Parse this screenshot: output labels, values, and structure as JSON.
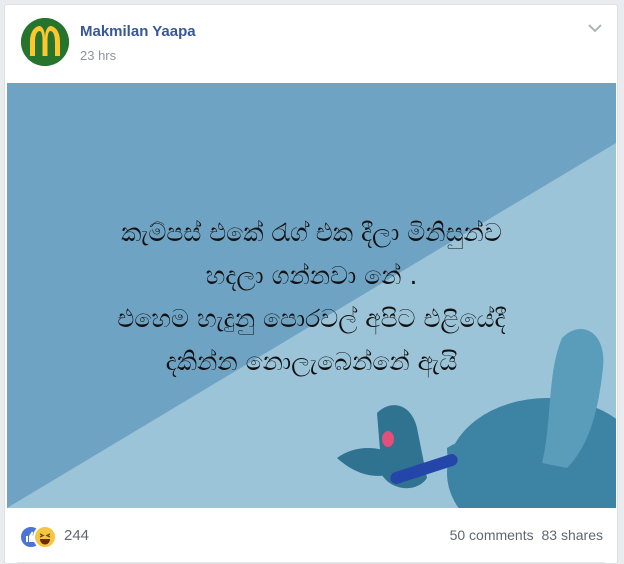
{
  "post": {
    "author": "Makmilan Yaapa",
    "time": "23 hrs",
    "text_lines": [
      "කැම්පස් එකේ රැග් එක දීලා මිනිසුන්ව",
      "හදලා ගන්නවා නේ .",
      "එහෙම හැදුනු පොරවල් අපිට එළියේදී",
      "දකින්න නොලැබෙන්නේ ඇයි"
    ],
    "background_colors": {
      "dark": "#6fa3c3",
      "light": "#9cc4d9",
      "character": "#2f7391"
    }
  },
  "footer": {
    "reaction_count": "244",
    "comments": "50 comments",
    "shares": "83 shares"
  },
  "icons": {
    "avatar": "golden-arches-logo",
    "menu": "chevron-down-icon",
    "reaction_1": "like-icon",
    "reaction_2": "haha-icon"
  }
}
